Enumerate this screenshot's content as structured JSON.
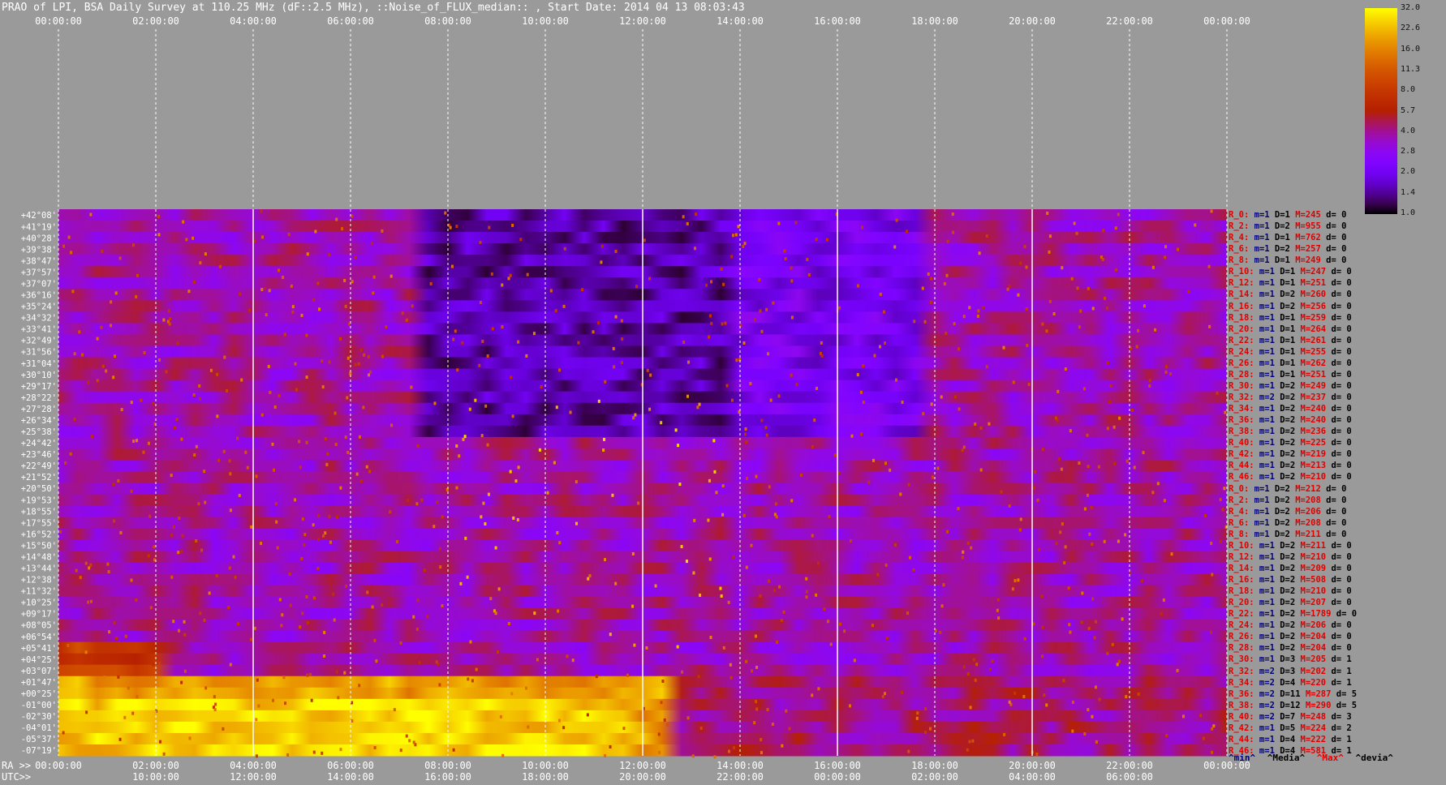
{
  "title": "PRAO of LPI, BSA Daily Survey at 110.25 MHz (dF::2.5 MHz), ::Noise_of_FLUX_median:: , Start Date: 2014 04 13 08:03:43",
  "chart_data": {
    "type": "heatmap",
    "top_axis_ticks": [
      "00:00:00",
      "02:00:00",
      "04:00:00",
      "06:00:00",
      "08:00:00",
      "10:00:00",
      "12:00:00",
      "14:00:00",
      "16:00:00",
      "18:00:00",
      "20:00:00",
      "22:00:00",
      "00:00:00"
    ],
    "ra_axis": {
      "label": "RA >>",
      "ticks": [
        "00:00:00",
        "02:00:00",
        "04:00:00",
        "06:00:00",
        "08:00:00",
        "10:00:00",
        "12:00:00",
        "14:00:00",
        "16:00:00",
        "18:00:00",
        "20:00:00",
        "22:00:00",
        "00:00:00"
      ]
    },
    "utc_axis": {
      "label": "UTC>>",
      "ticks": [
        "10:00:00",
        "12:00:00",
        "14:00:00",
        "16:00:00",
        "18:00:00",
        "20:00:00",
        "22:00:00",
        "00:00:00",
        "02:00:00",
        "04:00:00",
        "06:00:00"
      ]
    },
    "declinations": [
      "+42°08'",
      "+41°19'",
      "+40°28'",
      "+39°38'",
      "+38°47'",
      "+37°57'",
      "+37°07'",
      "+36°16'",
      "+35°24'",
      "+34°32'",
      "+33°41'",
      "+32°49'",
      "+31°56'",
      "+31°04'",
      "+30°10'",
      "+29°17'",
      "+28°22'",
      "+27°28'",
      "+26°34'",
      "+25°38'",
      "+24°42'",
      "+23°46'",
      "+22°49'",
      "+21°52'",
      "+20°50'",
      "+19°53'",
      "+18°55'",
      "+17°55'",
      "+16°52'",
      "+15°50'",
      "+14°48'",
      "+13°44'",
      "+12°38'",
      "+11°32'",
      "+10°25'",
      "+09°17'",
      "+08°05'",
      "+06°54'",
      "+05°41'",
      "+04°25'",
      "+03°07'",
      "+01°47'",
      "+00°25'",
      "-01°00'",
      "-02°30'",
      "-04°01'",
      "-05°37'",
      "-07°19'"
    ],
    "colorbar": {
      "ticks": [
        "32.0",
        "22.6",
        "16.0",
        "11.3",
        "8.0",
        "5.7",
        "4.0",
        "2.8",
        "2.0",
        "1.4",
        "1.0"
      ],
      "colormap": "gnuplot (black-blue-purple-red-yellow-white)"
    },
    "receivers": [
      {
        "r": "R_0:",
        "m": "m=1",
        "D": "D=1",
        "M": "M=245",
        "d": "d= 0"
      },
      {
        "r": "R_2:",
        "m": "m=1",
        "D": "D=2",
        "M": "M=955",
        "d": "d= 0"
      },
      {
        "r": "R_4:",
        "m": "m=1",
        "D": "D=1",
        "M": "M=762",
        "d": "d= 0"
      },
      {
        "r": "R_6:",
        "m": "m=1",
        "D": "D=2",
        "M": "M=257",
        "d": "d= 0"
      },
      {
        "r": "R_8:",
        "m": "m=1",
        "D": "D=1",
        "M": "M=249",
        "d": "d= 0"
      },
      {
        "r": "R_10:",
        "m": "m=1",
        "D": "D=1",
        "M": "M=247",
        "d": "d= 0"
      },
      {
        "r": "R_12:",
        "m": "m=1",
        "D": "D=1",
        "M": "M=251",
        "d": "d= 0"
      },
      {
        "r": "R_14:",
        "m": "m=1",
        "D": "D=2",
        "M": "M=260",
        "d": "d= 0"
      },
      {
        "r": "R_16:",
        "m": "m=1",
        "D": "D=2",
        "M": "M=256",
        "d": "d= 0"
      },
      {
        "r": "R_18:",
        "m": "m=1",
        "D": "D=1",
        "M": "M=259",
        "d": "d= 0"
      },
      {
        "r": "R_20:",
        "m": "m=1",
        "D": "D=1",
        "M": "M=264",
        "d": "d= 0"
      },
      {
        "r": "R_22:",
        "m": "m=1",
        "D": "D=1",
        "M": "M=261",
        "d": "d= 0"
      },
      {
        "r": "R_24:",
        "m": "m=1",
        "D": "D=1",
        "M": "M=255",
        "d": "d= 0"
      },
      {
        "r": "R_26:",
        "m": "m=1",
        "D": "D=1",
        "M": "M=262",
        "d": "d= 0"
      },
      {
        "r": "R_28:",
        "m": "m=1",
        "D": "D=1",
        "M": "M=251",
        "d": "d= 0"
      },
      {
        "r": "R_30:",
        "m": "m=1",
        "D": "D=2",
        "M": "M=249",
        "d": "d= 0"
      },
      {
        "r": "R_32:",
        "m": "m=2",
        "D": "D=2",
        "M": "M=237",
        "d": "d= 0"
      },
      {
        "r": "R_34:",
        "m": "m=1",
        "D": "D=2",
        "M": "M=240",
        "d": "d= 0"
      },
      {
        "r": "R_36:",
        "m": "m=1",
        "D": "D=2",
        "M": "M=240",
        "d": "d= 0"
      },
      {
        "r": "R_38:",
        "m": "m=1",
        "D": "D=2",
        "M": "M=236",
        "d": "d= 0"
      },
      {
        "r": "R_40:",
        "m": "m=1",
        "D": "D=2",
        "M": "M=225",
        "d": "d= 0"
      },
      {
        "r": "R_42:",
        "m": "m=1",
        "D": "D=2",
        "M": "M=219",
        "d": "d= 0"
      },
      {
        "r": "R_44:",
        "m": "m=1",
        "D": "D=2",
        "M": "M=213",
        "d": "d= 0"
      },
      {
        "r": "R_46:",
        "m": "m=1",
        "D": "D=2",
        "M": "M=210",
        "d": "d= 0"
      },
      {
        "r": "R_0:",
        "m": "m=1",
        "D": "D=2",
        "M": "M=212",
        "d": "d= 0"
      },
      {
        "r": "R_2:",
        "m": "m=1",
        "D": "D=2",
        "M": "M=208",
        "d": "d= 0"
      },
      {
        "r": "R_4:",
        "m": "m=1",
        "D": "D=2",
        "M": "M=206",
        "d": "d= 0"
      },
      {
        "r": "R_6:",
        "m": "m=1",
        "D": "D=2",
        "M": "M=208",
        "d": "d= 0"
      },
      {
        "r": "R_8:",
        "m": "m=1",
        "D": "D=2",
        "M": "M=211",
        "d": "d= 0"
      },
      {
        "r": "R_10:",
        "m": "m=1",
        "D": "D=2",
        "M": "M=211",
        "d": "d= 0"
      },
      {
        "r": "R_12:",
        "m": "m=1",
        "D": "D=2",
        "M": "M=210",
        "d": "d= 0"
      },
      {
        "r": "R_14:",
        "m": "m=1",
        "D": "D=2",
        "M": "M=209",
        "d": "d= 0"
      },
      {
        "r": "R_16:",
        "m": "m=1",
        "D": "D=2",
        "M": "M=508",
        "d": "d= 0"
      },
      {
        "r": "R_18:",
        "m": "m=1",
        "D": "D=2",
        "M": "M=210",
        "d": "d= 0"
      },
      {
        "r": "R_20:",
        "m": "m=1",
        "D": "D=2",
        "M": "M=207",
        "d": "d= 0"
      },
      {
        "r": "R_22:",
        "m": "m=1",
        "D": "D=2",
        "M": "M=1789",
        "d": "d= 0"
      },
      {
        "r": "R_24:",
        "m": "m=1",
        "D": "D=2",
        "M": "M=206",
        "d": "d= 0"
      },
      {
        "r": "R_26:",
        "m": "m=1",
        "D": "D=2",
        "M": "M=204",
        "d": "d= 0"
      },
      {
        "r": "R_28:",
        "m": "m=1",
        "D": "D=2",
        "M": "M=204",
        "d": "d= 0"
      },
      {
        "r": "R_30:",
        "m": "m=1",
        "D": "D=3",
        "M": "M=205",
        "d": "d= 1"
      },
      {
        "r": "R_32:",
        "m": "m=2",
        "D": "D=3",
        "M": "M=202",
        "d": "d= 1"
      },
      {
        "r": "R_34:",
        "m": "m=2",
        "D": "D=4",
        "M": "M=220",
        "d": "d= 1"
      },
      {
        "r": "R_36:",
        "m": "m=2",
        "D": "D=11",
        "M": "M=287",
        "d": "d= 5"
      },
      {
        "r": "R_38:",
        "m": "m=2",
        "D": "D=12",
        "M": "M=290",
        "d": "d= 5"
      },
      {
        "r": "R_40:",
        "m": "m=2",
        "D": "D=7",
        "M": "M=248",
        "d": "d= 3"
      },
      {
        "r": "R_42:",
        "m": "m=1",
        "D": "D=5",
        "M": "M=224",
        "d": "d= 2"
      },
      {
        "r": "R_44:",
        "m": "m=1",
        "D": "D=4",
        "M": "M=222",
        "d": "d= 1"
      },
      {
        "r": "R_46:",
        "m": "m=1",
        "D": "D=4",
        "M": "M=581",
        "d": "d= 1"
      }
    ],
    "footer_legend": [
      "^min^",
      "^Media^",
      "^Max^",
      "^devia^"
    ]
  }
}
